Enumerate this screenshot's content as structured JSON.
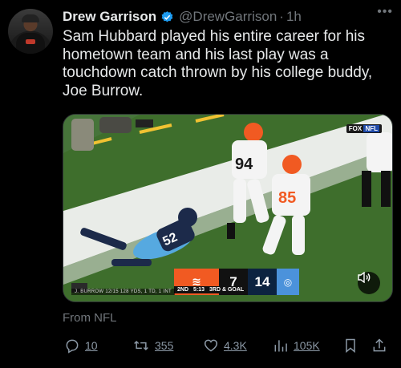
{
  "author": {
    "display_name": "Drew Garrison",
    "handle": "@DrewGarrison",
    "separator": "·",
    "time": "1h"
  },
  "tweet": {
    "text": "Sam Hubbard played his entire career for his hometown team and his last play was a touchdown catch thrown by his college buddy, Joe Burrow.",
    "source": "From NFL"
  },
  "media": {
    "network_bug": "FOX",
    "network_bug_suffix": "NFL",
    "scorebug": {
      "team1_score": "7",
      "team2_score": "14",
      "quarter": "2ND",
      "clock": "5:13",
      "down": "3RD & GOAL"
    },
    "player_stat": "J. BURROW 12/15 128 YDS, 1 TD, 1 INT"
  },
  "actions": {
    "replies": "10",
    "reposts": "355",
    "likes": "4.3K",
    "views": "105K"
  },
  "colors": {
    "background": "#000000",
    "text": "#e7e9ea",
    "muted": "#71767b",
    "verified": "#1d9bf0",
    "bengals_orange": "#f15a22"
  }
}
